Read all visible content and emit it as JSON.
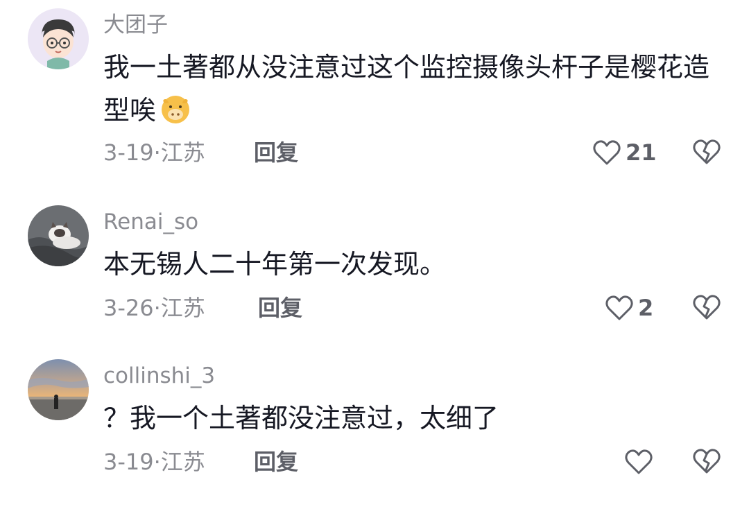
{
  "comments": [
    {
      "username": "大团子",
      "text": "我一土著都从没注意过这个监控摄像头杆子是樱花造型唉",
      "emoji": "cow-face-emoji",
      "date": "3-19",
      "location": "江苏",
      "reply_label": "回复",
      "like_count": "21"
    },
    {
      "username": "Renai_so",
      "text": "本无锡人二十年第一次发现。",
      "date": "3-26",
      "location": "江苏",
      "reply_label": "回复",
      "like_count": "2"
    },
    {
      "username": "collinshi_3",
      "text": "？我一个土著都没注意过，太细了",
      "date": "3-19",
      "location": "江苏",
      "reply_label": "回复",
      "like_count": ""
    }
  ],
  "meta_separator": "·",
  "colors": {
    "text": "#161823",
    "secondary": "#8a8b91",
    "action": "#5d5f67",
    "background": "#ffffff"
  },
  "icons": {
    "like": "heart-outline-icon",
    "dislike": "broken-heart-icon"
  }
}
